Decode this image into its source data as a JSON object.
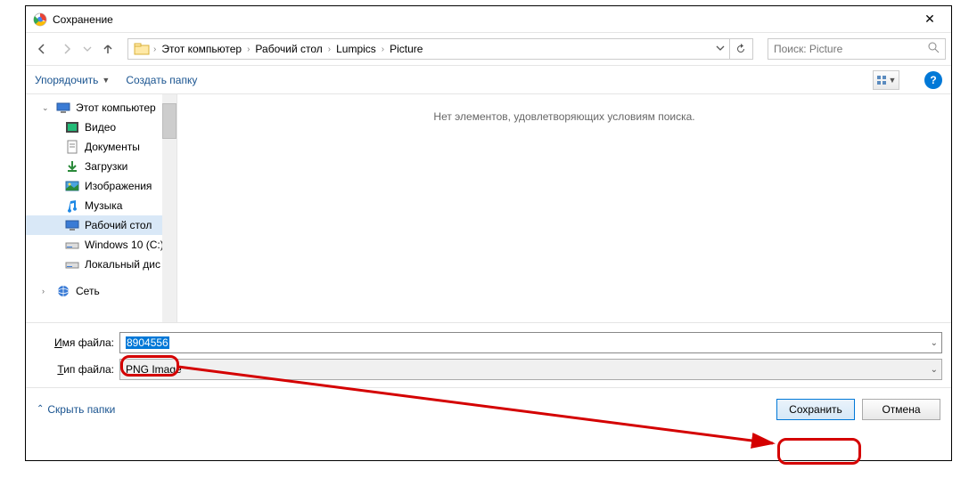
{
  "window": {
    "title": "Сохранение"
  },
  "breadcrumb": {
    "crumbs": [
      "Этот компьютер",
      "Рабочий стол",
      "Lumpics",
      "Picture"
    ]
  },
  "search": {
    "placeholder": "Поиск: Picture"
  },
  "toolbar": {
    "organize": "Упорядочить",
    "newfolder": "Создать папку"
  },
  "tree": {
    "items": [
      {
        "label": "Этот компьютер"
      },
      {
        "label": "Видео"
      },
      {
        "label": "Документы"
      },
      {
        "label": "Загрузки"
      },
      {
        "label": "Изображения"
      },
      {
        "label": "Музыка"
      },
      {
        "label": "Рабочий стол"
      },
      {
        "label": "Windows 10 (C:)"
      },
      {
        "label": "Локальный дис"
      },
      {
        "label": "Сеть"
      }
    ]
  },
  "content": {
    "empty": "Нет элементов, удовлетворяющих условиям поиска."
  },
  "form": {
    "filename_label_pre": "И",
    "filename_label_post": "мя файла:",
    "filename_value": "8904556",
    "filetype_label_pre": "Т",
    "filetype_label_post": "ип файла:",
    "filetype_value": "PNG Image"
  },
  "footer": {
    "hide_folders": "Скрыть папки",
    "save": "Сохранить",
    "cancel": "Отмена"
  }
}
